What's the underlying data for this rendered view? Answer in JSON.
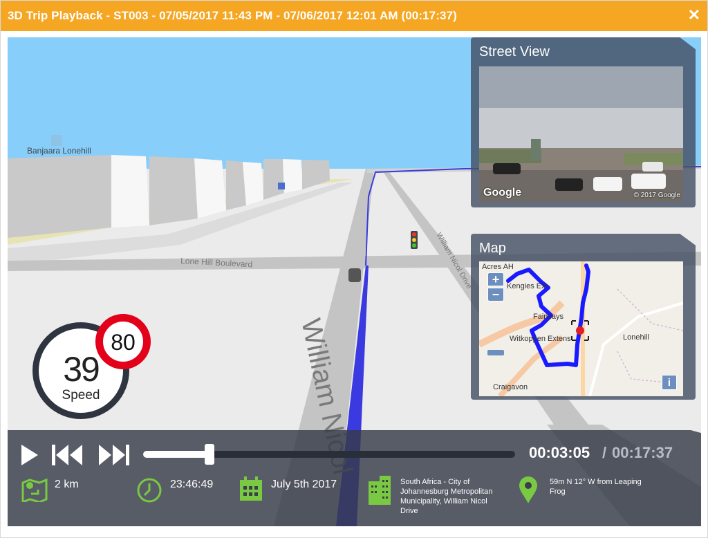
{
  "window": {
    "title": "3D Trip Playback - ST003 - 07/05/2017 11:43 PM - 07/06/2017 12:01 AM (00:17:37)",
    "close_glyph": "✕"
  },
  "scene": {
    "poi_label": "Banjaara Lonehill",
    "street_main": "William Nicol",
    "street_lone_hill": "Lone Hill Boulevard",
    "street_nicol_small": "William Nicol Drive"
  },
  "street_view": {
    "title": "Street View",
    "google_label": "Google",
    "copyright": "© 2017 Google"
  },
  "map": {
    "title": "Map",
    "zoom_in": "+",
    "zoom_out": "−",
    "info": "i",
    "labels": {
      "acres": "Acres AH",
      "kengies": "Kengies Ext",
      "fairways": "Fairways",
      "witkoppen": "Witkoppen Extens",
      "lonehill": "Lonehill",
      "craigavon": "Craigavon"
    }
  },
  "speed": {
    "value": "39",
    "label": "Speed",
    "limit": "80"
  },
  "playback": {
    "current_time": "00:03:05",
    "separator": "/",
    "total_time": "00:17:37",
    "progress_fraction": 0.178,
    "play_icon": "play-icon",
    "prev_icon": "skip-back-icon",
    "next_icon": "skip-forward-icon"
  },
  "info": {
    "distance": "2 km",
    "clock": "23:46:49",
    "date": "July 5th 2017",
    "location": "South Africa - City of Johannesburg Metropolitan Municipality, William Nicol Drive",
    "nearby": "59m N 12° W from Leaping Frog"
  },
  "colors": {
    "titlebar": "#f5a623",
    "accent_green": "#7ac943",
    "route_blue": "#2b2bd6",
    "limit_red": "#e3001b"
  }
}
